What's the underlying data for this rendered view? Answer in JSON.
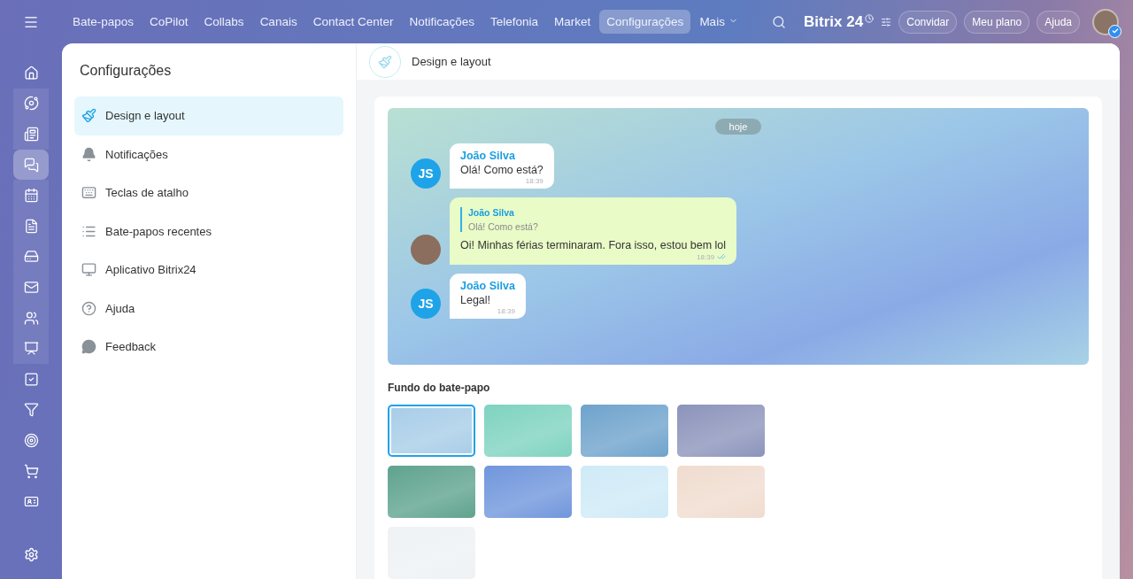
{
  "topbar": {
    "nav": [
      {
        "label": "Bate-papos",
        "selected": false
      },
      {
        "label": "CoPilot",
        "selected": false
      },
      {
        "label": "Collabs",
        "selected": false
      },
      {
        "label": "Canais",
        "selected": false
      },
      {
        "label": "Contact Center",
        "selected": false
      },
      {
        "label": "Notificações",
        "selected": false
      },
      {
        "label": "Telefonia",
        "selected": false
      },
      {
        "label": "Market",
        "selected": false
      },
      {
        "label": "Configurações",
        "selected": true
      }
    ],
    "more": "Mais",
    "logo": "Bitrix",
    "logo_number": "24",
    "buttons": [
      "Convidar",
      "Meu plano",
      "Ajuda"
    ]
  },
  "rail": [
    {
      "selected": false,
      "grouped": false
    },
    {
      "selected": false,
      "grouped": true
    },
    {
      "selected": false,
      "grouped": true
    },
    {
      "selected": true,
      "grouped": true
    },
    {
      "selected": false,
      "grouped": true
    },
    {
      "selected": false,
      "grouped": true
    },
    {
      "selected": false,
      "grouped": true
    },
    {
      "selected": false,
      "grouped": true
    },
    {
      "selected": false,
      "grouped": true
    },
    {
      "selected": false,
      "grouped": true
    },
    {
      "selected": false,
      "grouped": false
    },
    {
      "selected": false,
      "grouped": false
    },
    {
      "selected": false,
      "grouped": false
    },
    {
      "selected": false,
      "grouped": false
    },
    {
      "selected": false,
      "grouped": false
    }
  ],
  "settings": {
    "title": "Configurações",
    "items": [
      {
        "label": "Design e layout",
        "selected": true
      },
      {
        "label": "Notificações",
        "selected": false
      },
      {
        "label": "Teclas de atalho",
        "selected": false
      },
      {
        "label": "Bate-papos recentes",
        "selected": false
      },
      {
        "label": "Aplicativo Bitrix24",
        "selected": false
      },
      {
        "label": "Ajuda",
        "selected": false
      },
      {
        "label": "Feedback",
        "selected": false
      }
    ]
  },
  "content": {
    "title": "Design e layout",
    "date": "hoje",
    "messages": [
      {
        "kind": "incoming",
        "avatar": "JS",
        "author": "João Silva",
        "text": "Olá! Como está?",
        "time": "18:39"
      },
      {
        "kind": "outgoing",
        "quote_author": "João Silva",
        "quote_text": "Olá! Como está?",
        "text": "Oi! Minhas férias terminaram. Fora isso, estou bem lol",
        "time": "18:39",
        "read": true
      },
      {
        "kind": "incoming",
        "avatar": "JS",
        "author": "João Silva",
        "text": "Legal!",
        "time": "18:39"
      }
    ],
    "backgrounds_title": "Fundo do bate-papo",
    "backgrounds": [
      {
        "color": "#a8cde8",
        "selected": true
      },
      {
        "color": "#7fd3c0",
        "selected": false
      },
      {
        "color": "#6fa3cc",
        "selected": false
      },
      {
        "color": "#8c94bb",
        "selected": false
      },
      {
        "color": "#5fa38e",
        "selected": false
      },
      {
        "color": "#7096dc",
        "selected": false
      },
      {
        "color": "#cfeaf7",
        "selected": false
      },
      {
        "color": "#f0dccf",
        "selected": false
      },
      {
        "color": "#eef2f4",
        "selected": false
      }
    ]
  }
}
